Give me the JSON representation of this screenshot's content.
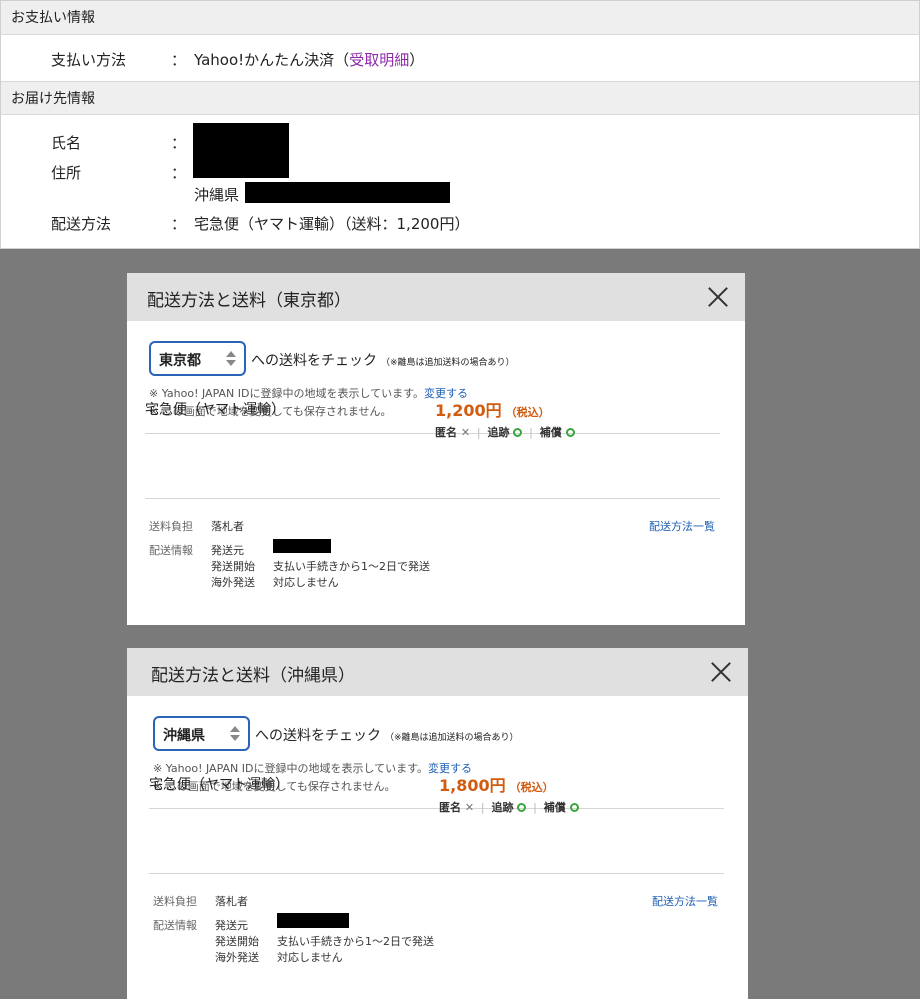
{
  "payment": {
    "heading": "お支払い情報",
    "method_label": "支払い方法",
    "colon": "：",
    "method_value": "Yahoo!かんたん決済",
    "paren_open": "（",
    "receipt_link": "受取明細",
    "paren_close": "）"
  },
  "delivery": {
    "heading": "お届け先情報",
    "name_label": "氏名",
    "address_label": "住所",
    "prefecture": "沖縄県",
    "ship_label": "配送方法",
    "ship_value": "宅急便（ヤマト運輸）（送料：1,200円）"
  },
  "modals": [
    {
      "title": "配送方法と送料（東京都）",
      "region": "東京都",
      "check_text": "への送料をチェック",
      "check_note": "（※離島は追加送料の場合あり）",
      "note1_prefix": "※ Yahoo! JAPAN IDに登録中の地域を表示しています。",
      "note1_link": "変更する",
      "note2": "※ この画面で地域を変更しても保存されません。",
      "carrier": "宅急便（ヤマト運輸）",
      "price": "1,200円",
      "tax": "（税込）",
      "anon_label": "匿名",
      "anon_mark": "✕",
      "track_label": "追跡",
      "comp_label": "補償",
      "sep": "|",
      "burden_label": "送料負担",
      "burden_value": "落札者",
      "method_list_link": "配送方法一覧",
      "info_label": "配送情報",
      "origin_label": "発送元",
      "start_label": "発送開始",
      "start_value": "支払い手続きから1〜2日で発送",
      "overseas_label": "海外発送",
      "overseas_value": "対応しません"
    },
    {
      "title": "配送方法と送料（沖縄県）",
      "region": "沖縄県",
      "check_text": "への送料をチェック",
      "check_note": "（※離島は追加送料の場合あり）",
      "note1_prefix": "※ Yahoo! JAPAN IDに登録中の地域を表示しています。",
      "note1_link": "変更する",
      "note2": "※ この画面で地域を変更しても保存されません。",
      "carrier": "宅急便（ヤマト運輸）",
      "price": "1,800円",
      "tax": "（税込）",
      "anon_label": "匿名",
      "anon_mark": "✕",
      "track_label": "追跡",
      "comp_label": "補償",
      "sep": "|",
      "burden_label": "送料負担",
      "burden_value": "落札者",
      "method_list_link": "配送方法一覧",
      "info_label": "配送情報",
      "origin_label": "発送元",
      "start_label": "発送開始",
      "start_value": "支払い手続きから1〜2日で発送",
      "overseas_label": "海外発送",
      "overseas_value": "対応しません"
    }
  ],
  "colors": {
    "price": "#d15b0e",
    "link_blue": "#1e5fb3",
    "link_purple": "#8e2aa8",
    "select_border": "#2a63b8",
    "check_green": "#3aa53a"
  }
}
